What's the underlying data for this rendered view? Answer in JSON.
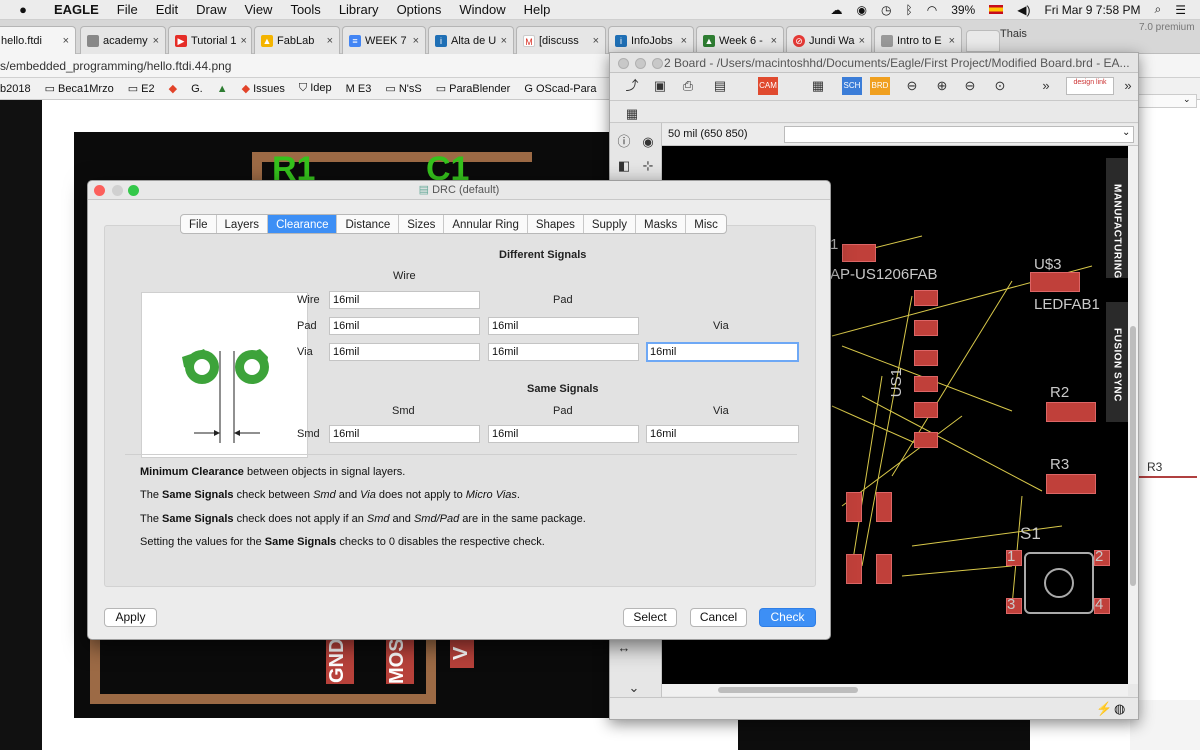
{
  "menubar": {
    "app_name": "EAGLE",
    "items": [
      "File",
      "Edit",
      "Draw",
      "View",
      "Tools",
      "Library",
      "Options",
      "Window",
      "Help"
    ],
    "battery": "39%",
    "clock": "Fri Mar 9  7:58 PM"
  },
  "browser": {
    "tabs": [
      {
        "label": "hello.ftdi",
        "close": "×"
      },
      {
        "label": "academy",
        "close": "×"
      },
      {
        "label": "Tutorial 1",
        "close": "×"
      },
      {
        "label": "FabLab",
        "close": "×"
      },
      {
        "label": "WEEK 7",
        "close": "×"
      },
      {
        "label": "Alta de U",
        "close": "×"
      },
      {
        "label": "[discuss",
        "close": "×"
      },
      {
        "label": "InfoJobs",
        "close": "×"
      },
      {
        "label": "Week 6 -",
        "close": "×"
      },
      {
        "label": "Jundi Wa",
        "close": "×"
      },
      {
        "label": "Intro to E",
        "close": "×"
      }
    ],
    "profile": "Thais",
    "url": "s/embedded_programming/hello.ftdi.44.png",
    "bookmarks": [
      "b2018",
      "Beca1Mrzo",
      "E2",
      "",
      "G.",
      "",
      "Issues",
      "Idep",
      "E3",
      "N'sS",
      "ParaBlender",
      "OScad-Para"
    ]
  },
  "background_image": {
    "r1_label": "R1",
    "c1_label": "C1",
    "pad_gnd": "GND",
    "pad_mosi": "MOSI",
    "pad_v": "V"
  },
  "board_window": {
    "title": "2 Board - /Users/macintoshhd/Documents/Eagle/First Project/Modified Board.brd - EA...",
    "grid_readout": "50 mil (650 850)",
    "side_tabs": [
      "MANUFACTURING",
      "FUSION SYNC"
    ],
    "labels": {
      "cap": "AP-US1206FAB",
      "u3": "U$3",
      "led": "LEDFAB1",
      "us1": "US1",
      "r2": "R2",
      "r3": "R3",
      "s1": "S1",
      "s1_pins": [
        "1",
        "2",
        "3",
        "4"
      ],
      "left_num": "1",
      "r3_right": "R3"
    },
    "toolbar_icons": [
      "open-icon",
      "save-icon",
      "print-icon",
      "cam-icon",
      "sch-icon",
      "brd-icon",
      "zoom-fit-icon",
      "zoom-in-icon",
      "zoom-out-icon",
      "zoom-select-icon"
    ],
    "design_link": "design link",
    "premium_text": "7.0 premium"
  },
  "drc": {
    "title": "DRC (default)",
    "tabs": [
      "File",
      "Layers",
      "Clearance",
      "Distance",
      "Sizes",
      "Annular Ring",
      "Shapes",
      "Supply",
      "Masks",
      "Misc"
    ],
    "selected_tab": "Clearance",
    "different_signals": {
      "heading": "Different Signals",
      "col_wire": "Wire",
      "col_pad": "Pad",
      "col_via": "Via",
      "row_wire": "Wire",
      "row_pad": "Pad",
      "row_via": "Via",
      "wire_wire": "16mil",
      "pad_wire": "16mil",
      "pad_pad": "16mil",
      "via_wire": "16mil",
      "via_pad": "16mil",
      "via_via": "16mil"
    },
    "same_signals": {
      "heading": "Same Signals",
      "col_smd": "Smd",
      "col_pad": "Pad",
      "col_via": "Via",
      "row_smd": "Smd",
      "smd_smd": "16mil",
      "smd_pad": "16mil",
      "smd_via": "16mil"
    },
    "notes": [
      {
        "parts": [
          {
            "b": "Minimum Clearance"
          },
          {
            "t": " between objects in signal layers."
          }
        ]
      },
      {
        "parts": [
          {
            "t": "The "
          },
          {
            "b": "Same Signals"
          },
          {
            "t": " check between "
          },
          {
            "i": "Smd"
          },
          {
            "t": " and "
          },
          {
            "i": "Via"
          },
          {
            "t": " does not apply to "
          },
          {
            "i": "Micro Vias"
          },
          {
            "t": "."
          }
        ]
      },
      {
        "parts": [
          {
            "t": "The "
          },
          {
            "b": "Same Signals"
          },
          {
            "t": " check does not apply if an "
          },
          {
            "i": "Smd"
          },
          {
            "t": " and "
          },
          {
            "i": "Smd/Pad"
          },
          {
            "t": " are in the same package."
          }
        ]
      },
      {
        "parts": [
          {
            "t": "Setting the values for the "
          },
          {
            "b": "Same Signals"
          },
          {
            "t": " checks to 0 disables the respective check."
          }
        ]
      }
    ],
    "buttons": {
      "apply": "Apply",
      "select": "Select",
      "cancel": "Cancel",
      "check": "Check"
    },
    "accent": "#3d8ff5"
  }
}
